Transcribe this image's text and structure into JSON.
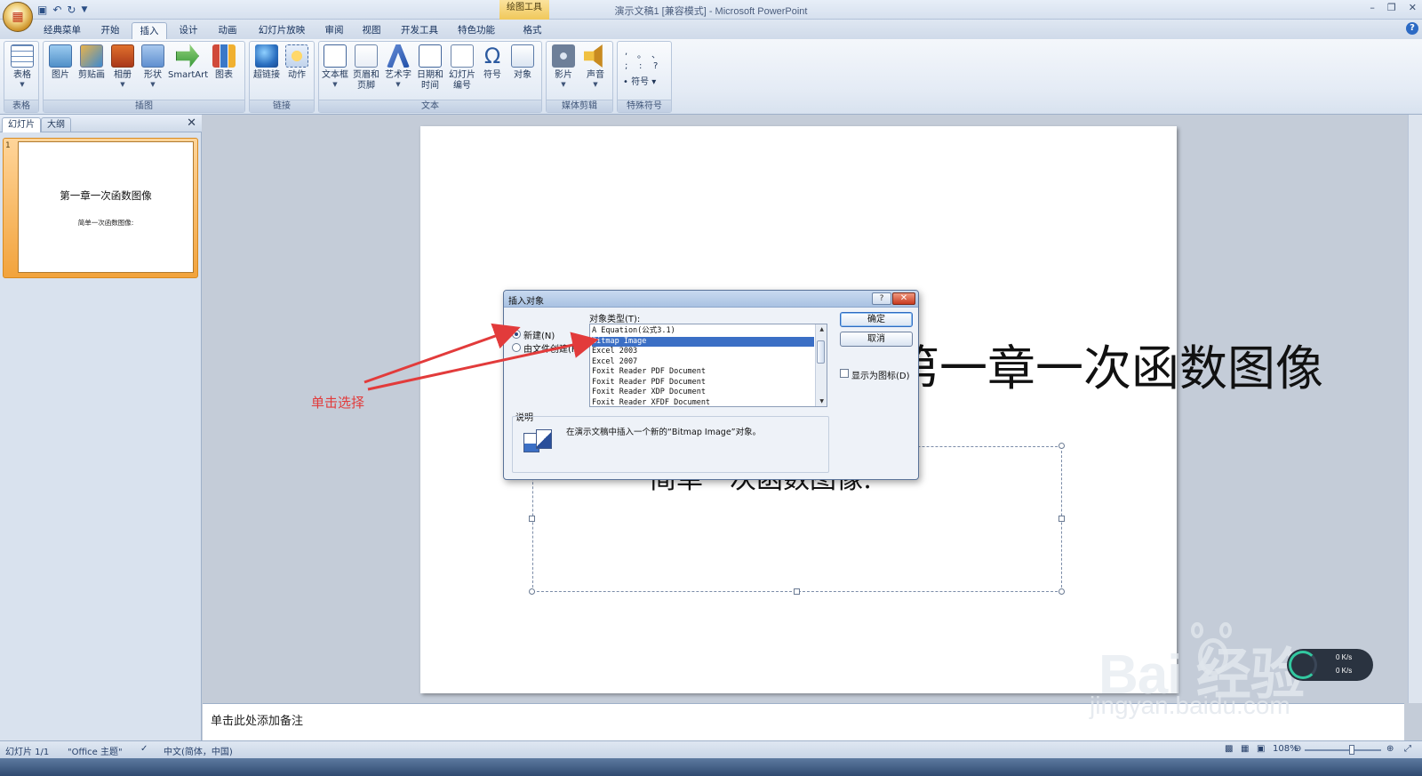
{
  "window": {
    "title": "演示文稿1 [兼容模式] - Microsoft PowerPoint",
    "context_tools": "绘图工具"
  },
  "tabs": [
    "经典菜单",
    "开始",
    "插入",
    "设计",
    "动画",
    "幻灯片放映",
    "审阅",
    "视图",
    "开发工具",
    "特色功能",
    "格式"
  ],
  "active_tab": "插入",
  "ribbon": {
    "groups": [
      {
        "label": "表格",
        "buttons": [
          "表格"
        ]
      },
      {
        "label": "插图",
        "buttons": [
          "图片",
          "剪贴画",
          "相册",
          "形状",
          "SmartArt",
          "图表"
        ]
      },
      {
        "label": "链接",
        "buttons": [
          "超链接",
          "动作"
        ]
      },
      {
        "label": "文本",
        "buttons": [
          "文本框",
          "页眉和页脚",
          "艺术字",
          "日期和时间",
          "幻灯片编号",
          "符号",
          "对象"
        ]
      },
      {
        "label": "媒体剪辑",
        "buttons": [
          "影片",
          "声音"
        ]
      },
      {
        "label": "特殊符号",
        "buttons": [
          "符号"
        ]
      }
    ],
    "special_symbols": [
      ",",
      "。",
      "、",
      ";",
      ":",
      "?"
    ]
  },
  "left_pane": {
    "tabs": [
      "幻灯片",
      "大纲"
    ],
    "slide_number": "1",
    "thumb_title": "第一章一次函数图像",
    "thumb_subtitle": "简单一次函数图像:"
  },
  "slide": {
    "title": "第一章一次函数图像",
    "subtitle": "简单一次函数图像:"
  },
  "notes_placeholder": "单击此处添加备注",
  "status": {
    "slide_info": "幻灯片 1/1",
    "theme": "\"Office 主题\"",
    "language": "中文(简体，中国)",
    "zoom": "108%"
  },
  "dialog": {
    "title": "插入对象",
    "option_new": "新建(N)",
    "option_from_file": "由文件创建(F)",
    "list_label": "对象类型(T):",
    "object_types": [
      "A Equation(公式3.1)",
      "Bitmap Image",
      "Excel 2003",
      "Excel 2007",
      "Foxit Reader PDF Document",
      "Foxit Reader PDF Document",
      "Foxit Reader XDP Document",
      "Foxit Reader XFDF Document"
    ],
    "selected_index": 1,
    "ok": "确定",
    "cancel": "取消",
    "display_as_icon": "显示为图标(D)",
    "desc_label": "说明",
    "desc_text": "在演示文稿中插入一个新的“Bitmap Image”对象。"
  },
  "annotation": "单击选择",
  "watermark": {
    "logo": "Bai 经验",
    "url": "jingyan.baidu.com"
  },
  "speed_meter": {
    "up": "0 K/s",
    "down": "0 K/s"
  },
  "colors": {
    "accent": "#3b6fc5",
    "annotation": "#e23b3b",
    "selection_highlight": "#f2a33c"
  }
}
